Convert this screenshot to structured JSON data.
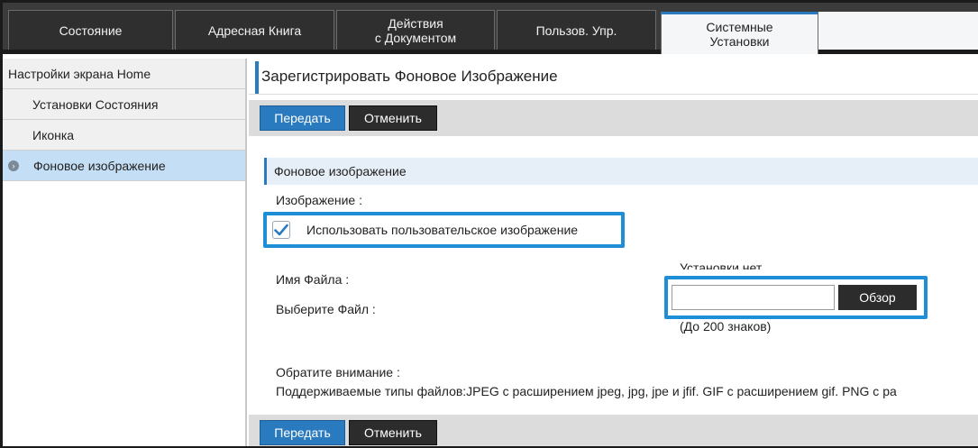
{
  "tabs": [
    {
      "label": "Состояние"
    },
    {
      "label": "Адресная Книга"
    },
    {
      "label": "Действия\nс Документом"
    },
    {
      "label": "Пользов. Упр."
    },
    {
      "label": "Системные\nУстановки"
    }
  ],
  "sidebar": {
    "items": [
      {
        "label": "Настройки экрана Home"
      },
      {
        "label": "Установки Состояния"
      },
      {
        "label": "Иконка"
      },
      {
        "label": "Фоновое изображение"
      }
    ]
  },
  "main": {
    "title": "Зарегистрировать Фоновое Изображение",
    "submit_label": "Передать",
    "cancel_label": "Отменить",
    "section_title": "Фоновое изображение",
    "image_label": "Изображение :",
    "use_custom_label": "Использовать пользовательское изображение",
    "use_custom_checked": true,
    "filename_label": "Имя Файла :",
    "filename_value": "Установки нет",
    "select_file_label": "Выберите Файл :",
    "browse_label": "Обзор",
    "limit_text": "(До 200 знаков)",
    "notice_title": "Обратите внимание :",
    "notice_text": "Поддерживаемые типы файлов:JPEG с расширением jpeg, jpg, jpe и jfif. GIF с расширением gif. PNG с ра"
  },
  "colors": {
    "accent": "#2a7ac0",
    "highlight": "#1e8fd6",
    "tabbar": "#3b3b3b",
    "sidebar_selected": "#c4dff5"
  }
}
